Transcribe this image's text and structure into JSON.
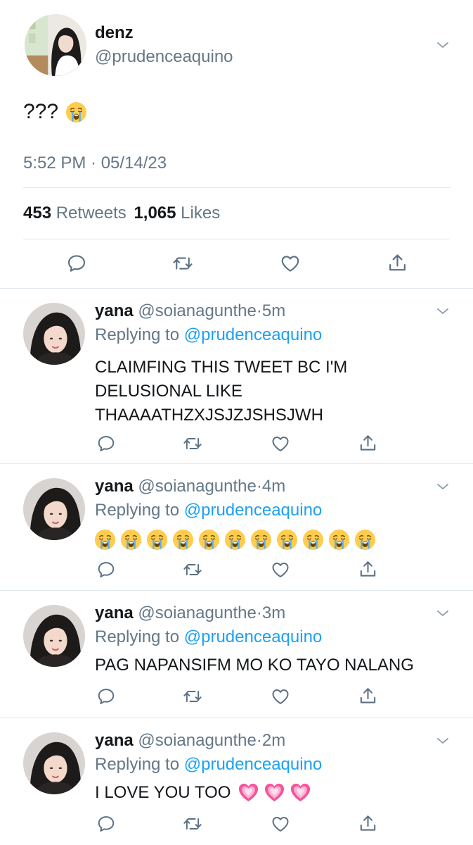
{
  "main_tweet": {
    "author": {
      "name": "denz",
      "handle": "@prudenceaquino"
    },
    "text": "???",
    "timestamp": "5:52 PM · 05/14/23",
    "stats": {
      "retweets_count": "453",
      "retweets_label": "Retweets",
      "likes_count": "1,065",
      "likes_label": "Likes"
    }
  },
  "replies": [
    {
      "name": "yana",
      "handle": "@soianagunthe",
      "time": "5m",
      "replying_label": "Replying to",
      "replying_to": "@prudenceaquino",
      "text": "CLAIMFING THIS TWEET BC I'M\nDELUSIONAL LIKE\nTHAAAATHZXJSJZJSHSJWH"
    },
    {
      "name": "yana",
      "handle": "@soianagunthe",
      "time": "4m",
      "replying_label": "Replying to",
      "replying_to": "@prudenceaquino",
      "text": ""
    },
    {
      "name": "yana",
      "handle": "@soianagunthe",
      "time": "3m",
      "replying_label": "Replying to",
      "replying_to": "@prudenceaquino",
      "text": "PAG NAPANSIFM MO KO TAYO NALANG"
    },
    {
      "name": "yana",
      "handle": "@soianagunthe",
      "time": "2m",
      "replying_label": "Replying to",
      "replying_to": "@prudenceaquino",
      "text": "I LOVE YOU TOO"
    }
  ],
  "icons": [
    "reply-icon",
    "retweet-icon",
    "like-icon",
    "share-icon",
    "chevron-down-icon",
    "crying-emoji",
    "pink-heart-emoji"
  ],
  "colors": {
    "link": "#1da1f2",
    "muted": "#657786",
    "divider": "#e1e8ed",
    "action_icon": "#5b7083",
    "emoji_face": "#ffcc4d",
    "tears": "#5dadec",
    "heart": "#f4569b"
  }
}
